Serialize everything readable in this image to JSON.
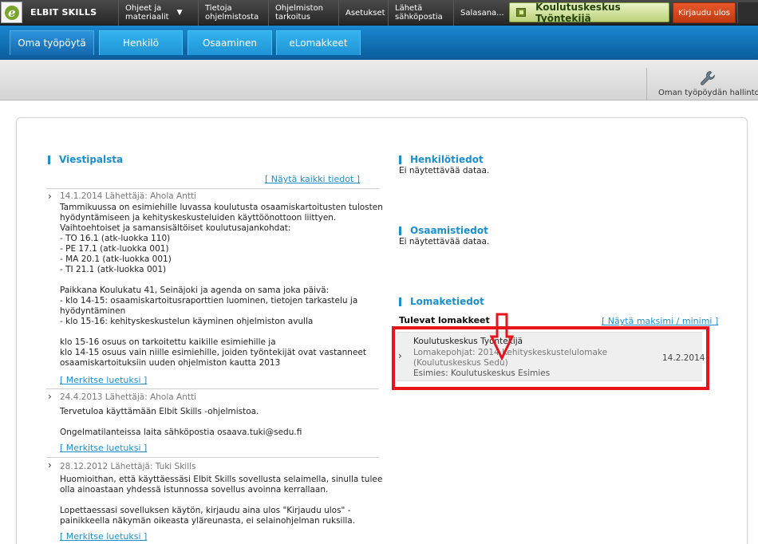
{
  "header": {
    "brand": "ELBIT SKILLS",
    "nav": [
      {
        "line1": "Ohjeet ja",
        "line2": "materiaalit",
        "caret": "▼"
      },
      {
        "line1": "Tietoja",
        "line2": "ohjelmistosta"
      },
      {
        "line1": "Ohjelmiston",
        "line2": "tarkoitus"
      },
      {
        "line1": "Asetukset",
        "line2": ""
      },
      {
        "line1": "Lähetä",
        "line2": "sähköpostia"
      },
      {
        "line1": "Salasana...",
        "line2": ""
      }
    ],
    "unit_label": "Koulutuskeskus Työntekijä",
    "logout_label": "Kirjaudu ulos"
  },
  "tabs": [
    {
      "label": "Oma työpöytä",
      "active": true
    },
    {
      "label": "Henkilö"
    },
    {
      "label": "Osaaminen"
    },
    {
      "label": "eLomakkeet"
    }
  ],
  "toolbar": {
    "manage_label": "Oman työpöydän hallinto",
    "icon": "wrench-icon"
  },
  "left": {
    "title": "Viestipalsta",
    "show_all": "[ Näytä kaikki tiedot ]",
    "mark_read": "[ Merkitse luetuksi ]",
    "messages": [
      {
        "meta": "14.1.2014 Lähettäjä: Ahola Antti",
        "lines": [
          "Tammikuussa on esimiehille luvassa koulutusta osaamiskartoitusten tulosten",
          "hyödyntämiseen ja kehityskeskusteluiden käyttöönottoon liittyen.",
          "Vaihtoehtoiset ja samansisältöiset koulutusajankohdat:",
          "- TO 16.1 (atk-luokka 110)",
          "- PE 17.1 (atk-luokka 001)",
          "- MA 20.1 (atk-luokka 001)",
          "- TI 21.1 (atk-luokka 001)",
          "",
          "Paikkana Koulukatu 41, Seinäjoki ja agenda on sama joka päivä:",
          "- klo 14-15: osaamiskartoitusraporttien luominen, tietojen tarkastelu ja",
          "hyödyntäminen",
          "- klo 15-16: kehityskeskustelun käyminen ohjelmiston avulla",
          "",
          "klo 15-16 osuus on tarkoitettu kaikille esimiehille ja",
          "klo 14-15 osuus vain niille esimiehille, joiden työntekijät ovat vastanneet",
          "osaamiskartoituksiin uuden ohjelmiston kautta 2013"
        ]
      },
      {
        "meta": "24.4.2013 Lähettäjä: Ahola Antti",
        "lines": [
          "Tervetuloa käyttämään Elbit Skills -ohjelmistoa.",
          "",
          "Ongelmatilanteissa laita sähköpostia osaava.tuki@sedu.fi"
        ]
      },
      {
        "meta": "28.12.2012 Lähettäjä: Tuki Skills",
        "lines": [
          "Huomioithan, että käyttäessäsi Elbit Skills sovellusta selaimella, sinulla tulee",
          "olla ainoastaan yhdessä istunnossa sovellus avoinna kerrallaan.",
          "",
          "Lopettaessasi sovelluksen käytön, kirjaudu aina ulos \"Kirjaudu ulos\" -",
          "painikkeella näkymän oikeasta yläreunasta, ei selainohjelman ruksilla."
        ]
      }
    ]
  },
  "right": {
    "henkilo": {
      "title": "Henkilötiedot",
      "nodata": "Ei näytettävää dataa."
    },
    "osaamis": {
      "title": "Osaamistiedot",
      "nodata": "Ei näytettävää dataa."
    },
    "lomake": {
      "title": "Lomaketiedot",
      "upcoming": "Tulevat lomakkeet",
      "toggle": "[ Näytä maksimi / minimi ]",
      "item": {
        "name": "Koulutuskeskus Työntekijä",
        "template": "Lomakepohjat: 2014 Kehityskeskustelulomake (Koulutuskeskus Sedu)",
        "supervisor": "Esimies: Koulutuskeskus Esimies",
        "date": "14.2.2014"
      }
    }
  },
  "colors": {
    "accent": "#1a8fcf",
    "highlight": "#e8141b",
    "unit": "#bcd27a",
    "logout": "#d44a1e"
  }
}
